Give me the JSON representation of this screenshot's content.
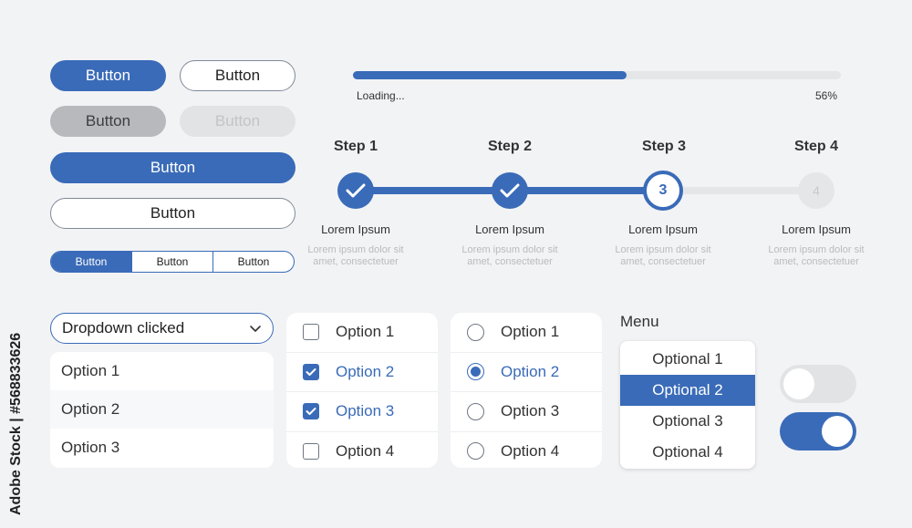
{
  "buttons": {
    "primary": "Button",
    "outline": "Button",
    "gray": "Button",
    "gray_light": "Button",
    "wide_primary": "Button",
    "wide_outline": "Button",
    "segmented": [
      "Button",
      "Button",
      "Button"
    ]
  },
  "progress": {
    "label": "Loading...",
    "percent_text": "56%",
    "value": 0.56
  },
  "stepper": {
    "steps": [
      {
        "label": "Step 1",
        "title": "Lorem Ipsum",
        "desc_line1": "Lorem ipsum dolor sit",
        "desc_line2": "amet, consectetuer",
        "state": "done"
      },
      {
        "label": "Step 2",
        "title": "Lorem Ipsum",
        "desc_line1": "Lorem ipsum dolor sit",
        "desc_line2": "amet, consectetuer",
        "state": "done"
      },
      {
        "label": "Step 3",
        "title": "Lorem Ipsum",
        "desc_line1": "Lorem ipsum dolor sit",
        "desc_line2": "amet, consectetuer",
        "state": "current",
        "number": "3"
      },
      {
        "label": "Step 4",
        "title": "Lorem Ipsum",
        "desc_line1": "Lorem ipsum dolor sit",
        "desc_line2": "amet, consectetuer",
        "state": "future",
        "number": "4"
      }
    ]
  },
  "dropdown": {
    "value": "Dropdown clicked",
    "options": [
      "Option 1",
      "Option 2",
      "Option 3"
    ]
  },
  "checkboxes": [
    {
      "label": "Option 1",
      "checked": false
    },
    {
      "label": "Option 2",
      "checked": true
    },
    {
      "label": "Option 3",
      "checked": true
    },
    {
      "label": "Option 4",
      "checked": false
    }
  ],
  "radios": [
    {
      "label": "Option 1",
      "checked": false
    },
    {
      "label": "Option 2",
      "checked": true
    },
    {
      "label": "Option 3",
      "checked": false
    },
    {
      "label": "Option 4",
      "checked": false
    }
  ],
  "menu": {
    "title": "Menu",
    "items": [
      "Optional 1",
      "Optional 2",
      "Optional 3",
      "Optional 4"
    ],
    "active_index": 1
  },
  "toggles": {
    "off": false,
    "on": true
  },
  "watermark": "Adobe Stock | #568833626",
  "colors": {
    "accent": "#3a6bb8",
    "background": "#f2f3f5"
  }
}
